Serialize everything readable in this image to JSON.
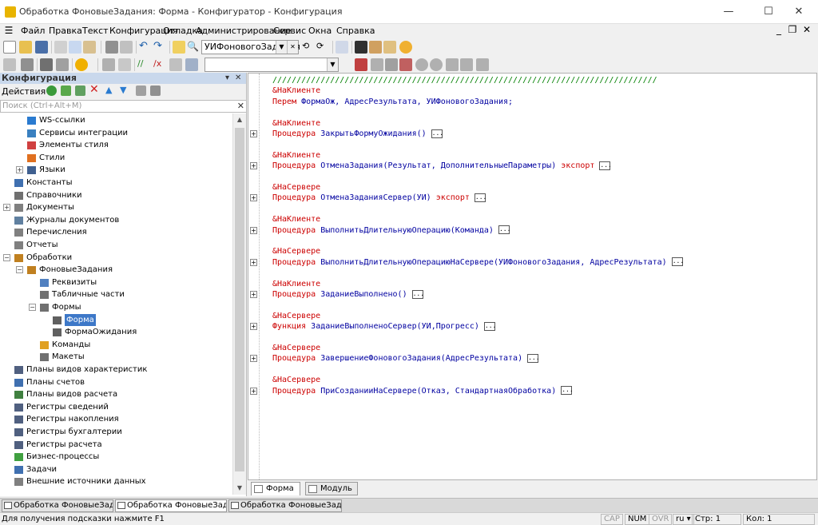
{
  "window": {
    "title": "Обработка ФоновыеЗадания: Форма - Конфигуратор - Конфигурация",
    "minimize": "—",
    "maximize": "☐",
    "close": "✕"
  },
  "menu": {
    "items": [
      "Файл",
      "Правка",
      "Текст",
      "Конфигурация",
      "Отладка",
      "Администрирование",
      "Сервис",
      "Окна",
      "Справка"
    ],
    "mdi_min": "_",
    "mdi_restore": "❐",
    "mdi_close": "✕"
  },
  "toolbar": {
    "search_combo_value": "УИФоновогоЗадания",
    "second_combo_value": ""
  },
  "left_panel": {
    "title": "Конфигурация",
    "pin": "▾",
    "close": "✕",
    "actions_label": "Действия ▾",
    "search_placeholder": "Поиск (Ctrl+Alt+M)",
    "search_clear": "✕",
    "tree": [
      {
        "label": "WS-ссылки",
        "icon_color": "#2a7bd0",
        "level": 2,
        "expander": ""
      },
      {
        "label": "Сервисы интеграции",
        "icon_color": "#3a80c0",
        "level": 2,
        "expander": ""
      },
      {
        "label": "Элементы стиля",
        "icon_color": "#d04040",
        "level": 2,
        "expander": ""
      },
      {
        "label": "Стили",
        "icon_color": "#e07020",
        "level": 2,
        "expander": ""
      },
      {
        "label": "Языки",
        "icon_color": "#406090",
        "level": 2,
        "expander": "+"
      },
      {
        "label": "Константы",
        "icon_color": "#4070b0",
        "level": 1,
        "expander": ""
      },
      {
        "label": "Справочники",
        "icon_color": "#707070",
        "level": 1,
        "expander": ""
      },
      {
        "label": "Документы",
        "icon_color": "#808080",
        "level": 1,
        "expander": "+"
      },
      {
        "label": "Журналы документов",
        "icon_color": "#6080a0",
        "level": 1,
        "expander": ""
      },
      {
        "label": "Перечисления",
        "icon_color": "#808080",
        "level": 1,
        "expander": ""
      },
      {
        "label": "Отчеты",
        "icon_color": "#808080",
        "level": 1,
        "expander": ""
      },
      {
        "label": "Обработки",
        "icon_color": "#c08020",
        "level": 1,
        "expander": "−"
      },
      {
        "label": "ФоновыеЗадания",
        "icon_color": "#c08020",
        "level": 2,
        "expander": "−"
      },
      {
        "label": "Реквизиты",
        "icon_color": "#5080c0",
        "level": 3,
        "expander": ""
      },
      {
        "label": "Табличные части",
        "icon_color": "#707070",
        "level": 3,
        "expander": ""
      },
      {
        "label": "Формы",
        "icon_color": "#707070",
        "level": 3,
        "expander": "−"
      },
      {
        "label": "Форма",
        "icon_color": "#606060",
        "level": 4,
        "expander": "",
        "selected": true
      },
      {
        "label": "ФормаОжидания",
        "icon_color": "#606060",
        "level": 4,
        "expander": ""
      },
      {
        "label": "Команды",
        "icon_color": "#e0a020",
        "level": 3,
        "expander": ""
      },
      {
        "label": "Макеты",
        "icon_color": "#707070",
        "level": 3,
        "expander": ""
      },
      {
        "label": "Планы видов характеристик",
        "icon_color": "#506080",
        "level": 1,
        "expander": ""
      },
      {
        "label": "Планы счетов",
        "icon_color": "#4070b0",
        "level": 1,
        "expander": ""
      },
      {
        "label": "Планы видов расчета",
        "icon_color": "#408040",
        "level": 1,
        "expander": ""
      },
      {
        "label": "Регистры сведений",
        "icon_color": "#506080",
        "level": 1,
        "expander": ""
      },
      {
        "label": "Регистры накопления",
        "icon_color": "#506080",
        "level": 1,
        "expander": ""
      },
      {
        "label": "Регистры бухгалтерии",
        "icon_color": "#506080",
        "level": 1,
        "expander": ""
      },
      {
        "label": "Регистры расчета",
        "icon_color": "#506080",
        "level": 1,
        "expander": ""
      },
      {
        "label": "Бизнес-процессы",
        "icon_color": "#40a040",
        "level": 1,
        "expander": ""
      },
      {
        "label": "Задачи",
        "icon_color": "#4070b0",
        "level": 1,
        "expander": ""
      },
      {
        "label": "Внешние источники данных",
        "icon_color": "#808080",
        "level": 1,
        "expander": ""
      }
    ]
  },
  "editor": {
    "lines": [
      {
        "kind": "comment",
        "text": "////////////////////////////////////////////////////////////////////////////////"
      },
      {
        "kind": "directive",
        "text": "&НаКлиенте"
      },
      {
        "kind": "declare",
        "kw": "Перем",
        "rest": " ФормаОж, АдресРезультата, УИФоновогоЗадания;"
      },
      {
        "kind": "blank"
      },
      {
        "kind": "directive",
        "text": "&НаКлиенте"
      },
      {
        "kind": "proc",
        "kw": "Процедура",
        "name": " ЗакрытьФормуОжидания",
        "args": "()",
        "export": ""
      },
      {
        "kind": "blank"
      },
      {
        "kind": "directive",
        "text": "&НаКлиенте"
      },
      {
        "kind": "proc",
        "kw": "Процедура",
        "name": " ОтменаЗадания",
        "args": "(Результат, ДополнительныеПараметры)",
        "export": "  экспорт"
      },
      {
        "kind": "blank"
      },
      {
        "kind": "directive",
        "text": "&НаСервере"
      },
      {
        "kind": "proc",
        "kw": "Процедура",
        "name": " ОтменаЗаданияСервер",
        "args": "(УИ)",
        "export": "  экспорт"
      },
      {
        "kind": "blank"
      },
      {
        "kind": "directive",
        "text": "&НаКлиенте"
      },
      {
        "kind": "proc",
        "kw": "Процедура",
        "name": " ВыполнитьДлительнуюОперацию",
        "args": "(Команда)",
        "export": ""
      },
      {
        "kind": "blank"
      },
      {
        "kind": "directive",
        "text": "&НаСервере"
      },
      {
        "kind": "proc",
        "kw": "Процедура",
        "name": " ВыполнитьДлительнуюОперациюНаСервере",
        "args": "(УИФоновогоЗадания, АдресРезультата)",
        "export": ""
      },
      {
        "kind": "blank"
      },
      {
        "kind": "directive",
        "text": "&НаКлиенте"
      },
      {
        "kind": "proc",
        "kw": "Процедура",
        "name": " ЗаданиеВыполнено",
        "args": "()",
        "export": ""
      },
      {
        "kind": "blank"
      },
      {
        "kind": "directive",
        "text": "&НаСервере"
      },
      {
        "kind": "proc",
        "kw": "Функция",
        "name": " ЗаданиеВыполненоСервер",
        "args": "(УИ,Прогресс)",
        "export": ""
      },
      {
        "kind": "blank"
      },
      {
        "kind": "directive",
        "text": "&НаСервере"
      },
      {
        "kind": "proc",
        "kw": "Процедура",
        "name": " ЗавершениеФоновогоЗадания",
        "args": "(АдресРезультата)",
        "export": ""
      },
      {
        "kind": "blank"
      },
      {
        "kind": "directive",
        "text": "&НаСервере"
      },
      {
        "kind": "proc",
        "kw": "Процедура",
        "name": " ПриСозданииНаСервере",
        "args": "(Отказ, СтандартнаяОбработка)",
        "export": ""
      }
    ],
    "fold_glyph": "+",
    "ellipsis": "...",
    "tabs": [
      {
        "label": "Форма",
        "active": true
      },
      {
        "label": "Модуль",
        "active": false
      }
    ]
  },
  "taskbar": [
    {
      "label": "Обработка ФоновыеЗадани...",
      "active": false
    },
    {
      "label": "Обработка ФоновыеЗадани...",
      "active": true
    },
    {
      "label": "Обработка ФоновыеЗадани...",
      "active": false
    }
  ],
  "status": {
    "hint": "Для получения подсказки нажмите F1",
    "cap": "CAP",
    "num": "NUM",
    "ovr": "OVR",
    "lang": "ru ▾",
    "line": "Стр: 1",
    "col": "Кол: 1"
  },
  "colors": {
    "keyword": "#cc0000",
    "identifier": "#0000a0",
    "comment": "#008000",
    "selection": "#3d78c8"
  }
}
